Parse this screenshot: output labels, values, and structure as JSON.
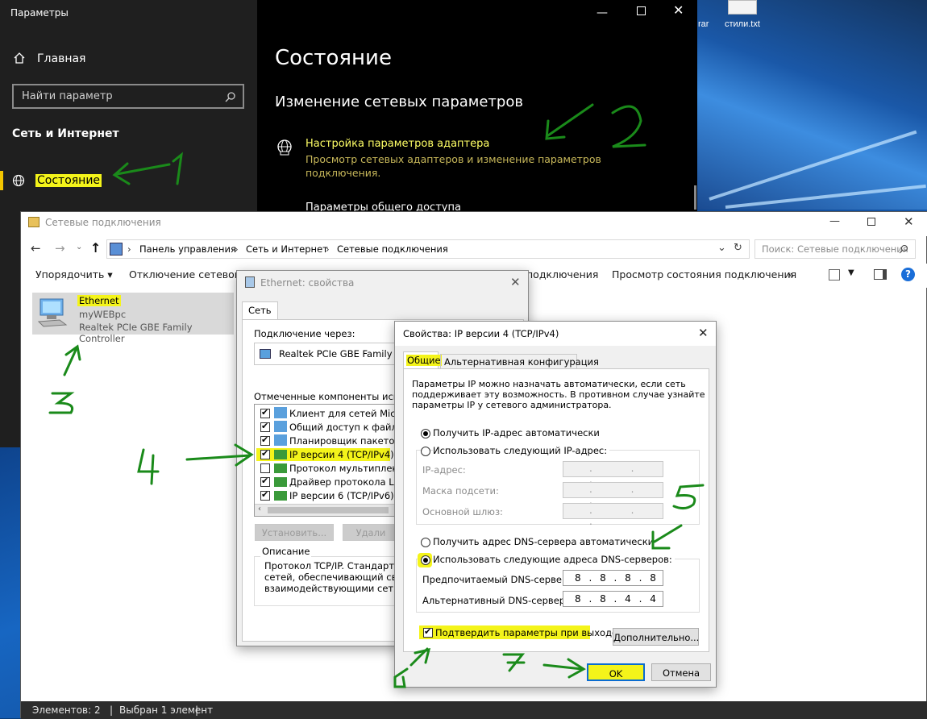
{
  "desktop": {
    "file_label": "стили.txt",
    "partial_label": "rar"
  },
  "settings": {
    "window_title": "Параметры",
    "home": "Главная",
    "search_placeholder": "Найти параметр",
    "section": "Сеть и Интернет",
    "status_item": "Состояние",
    "page_title": "Состояние",
    "subtitle": "Изменение сетевых параметров",
    "adapter_link": "Настройка параметров адаптера",
    "adapter_desc1": "Просмотр сетевых адаптеров и изменение параметров",
    "adapter_desc2": "подключения.",
    "sharing_partial": "Параметры общего доступа"
  },
  "explorer": {
    "title": "Сетевые подключения",
    "breadcrumb": [
      "Панель управления",
      "Сеть и Интернет",
      "Сетевые подключения"
    ],
    "search_placeholder": "Поиск: Сетевые подключения",
    "cmd_organize": "Упорядочить",
    "cmd_disconnect": "Отключение сетевого ус",
    "cmd_partial": "подключения",
    "cmd_view_status": "Просмотр состояния подключения",
    "cmd_more": "»",
    "adapter": {
      "name": "Ethernet",
      "network": "myWEBpc",
      "device": "Realtek PCIe GBE Family Controller"
    },
    "status_count": "Элементов: 2",
    "status_selected": "Выбран 1 элемент"
  },
  "eth_dialog": {
    "title": "Ethernet: свойства",
    "tab": "Сеть",
    "connect_via": "Подключение через:",
    "adapter": "Realtek PCIe GBE Family Cont",
    "components_label": "Отмеченные компоненты использ",
    "components": [
      {
        "label": "Клиент для сетей Microsof",
        "checked": true
      },
      {
        "label": "Общий доступ к файлам и",
        "checked": true
      },
      {
        "label": "Планировщик пакетов Qo",
        "checked": true
      },
      {
        "label": "IP версии 4 (TCP/IPv4)",
        "checked": true
      },
      {
        "label": "Протокол мультиплексор",
        "checked": false
      },
      {
        "label": "Драйвер протокола LLDP",
        "checked": true
      },
      {
        "label": "IP версии 6 (TCP/IPv6)",
        "checked": true
      }
    ],
    "install_btn": "Установить...",
    "remove_btn": "Удали",
    "desc_legend": "Описание",
    "desc_lines": [
      "Протокол TCP/IP. Стандартный",
      "сетей, обеспечивающий связь м",
      "взаимодействующими сетями."
    ]
  },
  "ipv4_dialog": {
    "title": "Свойства: IP версии 4 (TCP/IPv4)",
    "tab_general": "Общие",
    "tab_alt": "Альтернативная конфигурация",
    "intro": [
      "Параметры IP можно назначать автоматически, если сеть",
      "поддерживает эту возможность. В противном случае узнайте",
      "параметры IP у сетевого администратора."
    ],
    "auto_ip": "Получить IP-адрес автоматически",
    "manual_ip": "Использовать следующий IP-адрес:",
    "ip_label": "IP-адрес:",
    "mask_label": "Маска подсети:",
    "gateway_label": "Основной шлюз:",
    "empty_ip": ". . .",
    "auto_dns": "Получить адрес DNS-сервера автоматически",
    "manual_dns": "Использовать следующие адреса DNS-серверов:",
    "pref_dns_label": "Предпочитаемый DNS-сервер:",
    "pref_dns": "8 . 8 . 8 . 8",
    "alt_dns_label": "Альтернативный DNS-сервер:",
    "alt_dns": "8 . 8 . 4 . 4",
    "validate": "Подтвердить параметры при выходе",
    "advanced_btn": "Дополнительно...",
    "ok_btn": "OK",
    "cancel_btn": "Отмена"
  },
  "annotations": [
    "1",
    "2",
    "3",
    "4",
    "5",
    "6",
    "7"
  ],
  "colors": {
    "accent_yellow": "#f4f41a",
    "settings_link": "#ffff66",
    "green_marker": "#1a8a1a"
  }
}
